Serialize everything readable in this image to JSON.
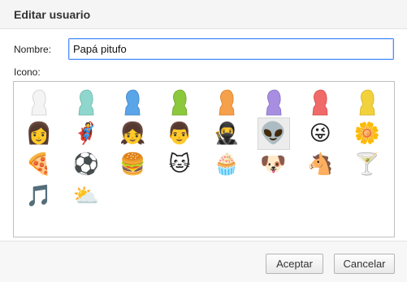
{
  "dialog": {
    "title": "Editar usuario",
    "name_label": "Nombre:",
    "name_value": "Papá pitufo",
    "icon_label": "Icono:"
  },
  "icons": [
    {
      "name": "silhouette-white-icon",
      "kind": "silhouette",
      "color": "#f4f4f4",
      "stroke": "#cfcfcf"
    },
    {
      "name": "silhouette-teal-icon",
      "kind": "silhouette",
      "color": "#8fd6cc",
      "stroke": "#6bb8ad"
    },
    {
      "name": "silhouette-blue-icon",
      "kind": "silhouette",
      "color": "#5aa4e8",
      "stroke": "#3f86c9"
    },
    {
      "name": "silhouette-green-icon",
      "kind": "silhouette",
      "color": "#8cc83c",
      "stroke": "#6da42a"
    },
    {
      "name": "silhouette-orange-icon",
      "kind": "silhouette",
      "color": "#f5a04a",
      "stroke": "#d9822c"
    },
    {
      "name": "silhouette-purple-icon",
      "kind": "silhouette",
      "color": "#a78ee0",
      "stroke": "#8670c5"
    },
    {
      "name": "silhouette-red-icon",
      "kind": "silhouette",
      "color": "#f06a6a",
      "stroke": "#d24c4c"
    },
    {
      "name": "silhouette-yellow-icon",
      "kind": "silhouette",
      "color": "#f2d23c",
      "stroke": "#d2b124"
    },
    {
      "name": "businesswoman-avatar-icon",
      "kind": "glyph",
      "glyph": "👩"
    },
    {
      "name": "superhero-avatar-icon",
      "kind": "glyph",
      "glyph": "🦸"
    },
    {
      "name": "woman-sunglasses-avatar-icon",
      "kind": "glyph",
      "glyph": "👧"
    },
    {
      "name": "man-avatar-icon",
      "kind": "glyph",
      "glyph": "👨"
    },
    {
      "name": "ninja-avatar-icon",
      "kind": "glyph",
      "glyph": "🥷"
    },
    {
      "name": "alien-avatar-icon",
      "kind": "glyph",
      "glyph": "👽",
      "selected": true
    },
    {
      "name": "smiley-face-icon",
      "kind": "glyph",
      "glyph": "😜"
    },
    {
      "name": "daisy-flower-icon",
      "kind": "glyph",
      "glyph": "🌼"
    },
    {
      "name": "pizza-slice-icon",
      "kind": "glyph",
      "glyph": "🍕"
    },
    {
      "name": "soccer-ball-icon",
      "kind": "glyph",
      "glyph": "⚽"
    },
    {
      "name": "burger-icon",
      "kind": "glyph",
      "glyph": "🍔"
    },
    {
      "name": "cat-icon",
      "kind": "glyph",
      "glyph": "🐱"
    },
    {
      "name": "cupcake-icon",
      "kind": "glyph",
      "glyph": "🧁"
    },
    {
      "name": "puppy-icon",
      "kind": "glyph",
      "glyph": "🐶"
    },
    {
      "name": "horse-icon",
      "kind": "glyph",
      "glyph": "🐴"
    },
    {
      "name": "cocktail-glass-icon",
      "kind": "glyph",
      "glyph": "🍸"
    },
    {
      "name": "music-note-icon",
      "kind": "glyph",
      "glyph": "🎵"
    },
    {
      "name": "sun-cloud-icon",
      "kind": "glyph",
      "glyph": "⛅"
    }
  ],
  "buttons": {
    "accept": "Aceptar",
    "cancel": "Cancelar"
  }
}
